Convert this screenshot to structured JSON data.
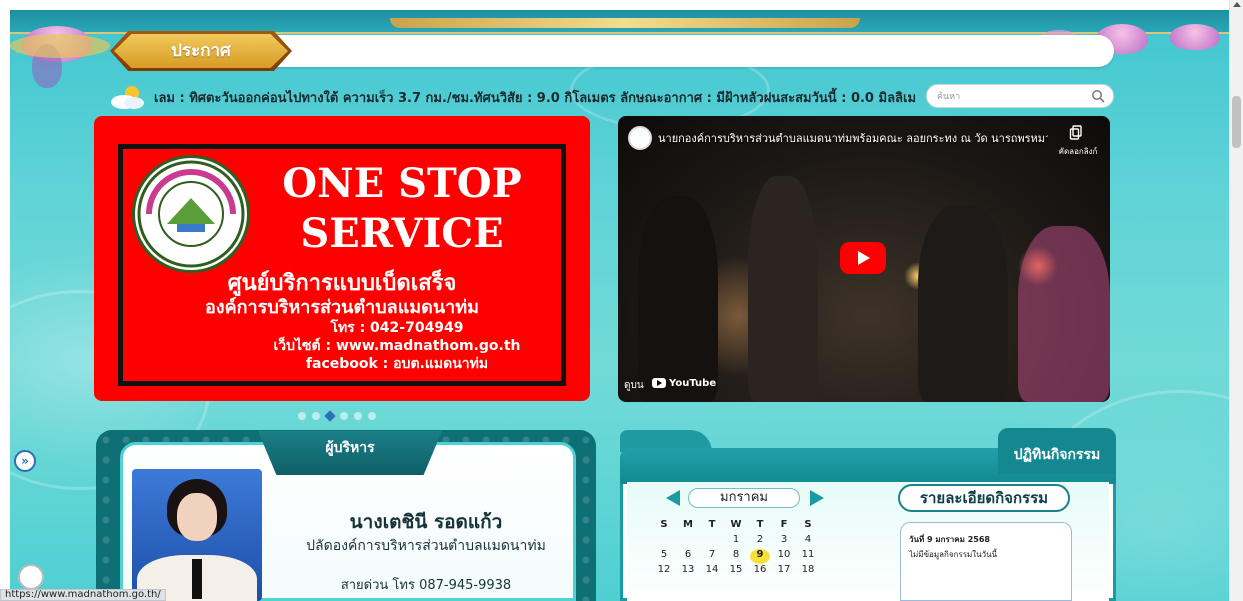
{
  "announcement": {
    "label": "ประกาศ"
  },
  "weather": {
    "text": "เลม : ทิศตะวันออกค่อนไปทางใต้ ความเร็ว 3.7 กม./ชม.ทัศนวิสัย : 9.0 กิโลเมตร ลักษณะอากาศ : มีฝ้าหลัวฝนสะสมวันนี้ : 0.0 มิลลิเม"
  },
  "search": {
    "placeholder": "ค้นหา"
  },
  "banner": {
    "title_line1": "ONE STOP",
    "title_line2": "SERVICE",
    "subtitle": "ศูนย์บริการแบบเบ็ดเสร็จ",
    "org": "องค์การบริหารส่วนตำบลแมดนาท่ม",
    "phone": "โทร : 042-704949",
    "website": "เว็บไซต์ : www.madnathom.go.th",
    "facebook": "facebook : อบต.แมดนาท่ม",
    "logo_text": "อบต.แมดนาท่ม"
  },
  "carousel": {
    "dot_count": 6,
    "active_index": 2
  },
  "video": {
    "title": "นายกองค์การบริหารส่วนตำบลแมดนาท่มพร้อมคณะ ลอยกระทง ณ วัด นารถพรหมว...",
    "copy_label": "คัดลอกลิงก์",
    "watch_on": "ดูบน",
    "platform": "YouTube"
  },
  "executive": {
    "section_title": "ผู้บริหาร",
    "name": "นางเตชินี รอดแก้ว",
    "position": "ปลัดองค์การบริหารส่วนตำบลแมดนาท่ม",
    "hotline": "สายด่วน โทร 087-945-9938"
  },
  "calendar": {
    "section_title": "ปฏิทินกิจกรรม",
    "month": "มกราคม",
    "weekdays": [
      "S",
      "M",
      "T",
      "W",
      "T",
      "F",
      "S"
    ],
    "rows": [
      [
        "",
        "",
        "",
        "1",
        "2",
        "3",
        "4"
      ],
      [
        "5",
        "6",
        "7",
        "8",
        "9",
        "10",
        "11"
      ],
      [
        "12",
        "13",
        "14",
        "15",
        "16",
        "17",
        "18"
      ]
    ],
    "today": "9",
    "detail_title": "รายละเอียดกิจกรรม",
    "detail_date": "วันที่ 9 มกราคม 2568",
    "detail_note": "ไม่มีข้อมูลกิจกรรมในวันนี้"
  },
  "side": {
    "expand_glyph": "»"
  },
  "status": {
    "url": "https://www.madnathom.go.th/"
  },
  "colors": {
    "banner_red": "#ff0000",
    "teal_dark": "#138891",
    "gold": "#d89b24",
    "today": "#f5e13a"
  }
}
